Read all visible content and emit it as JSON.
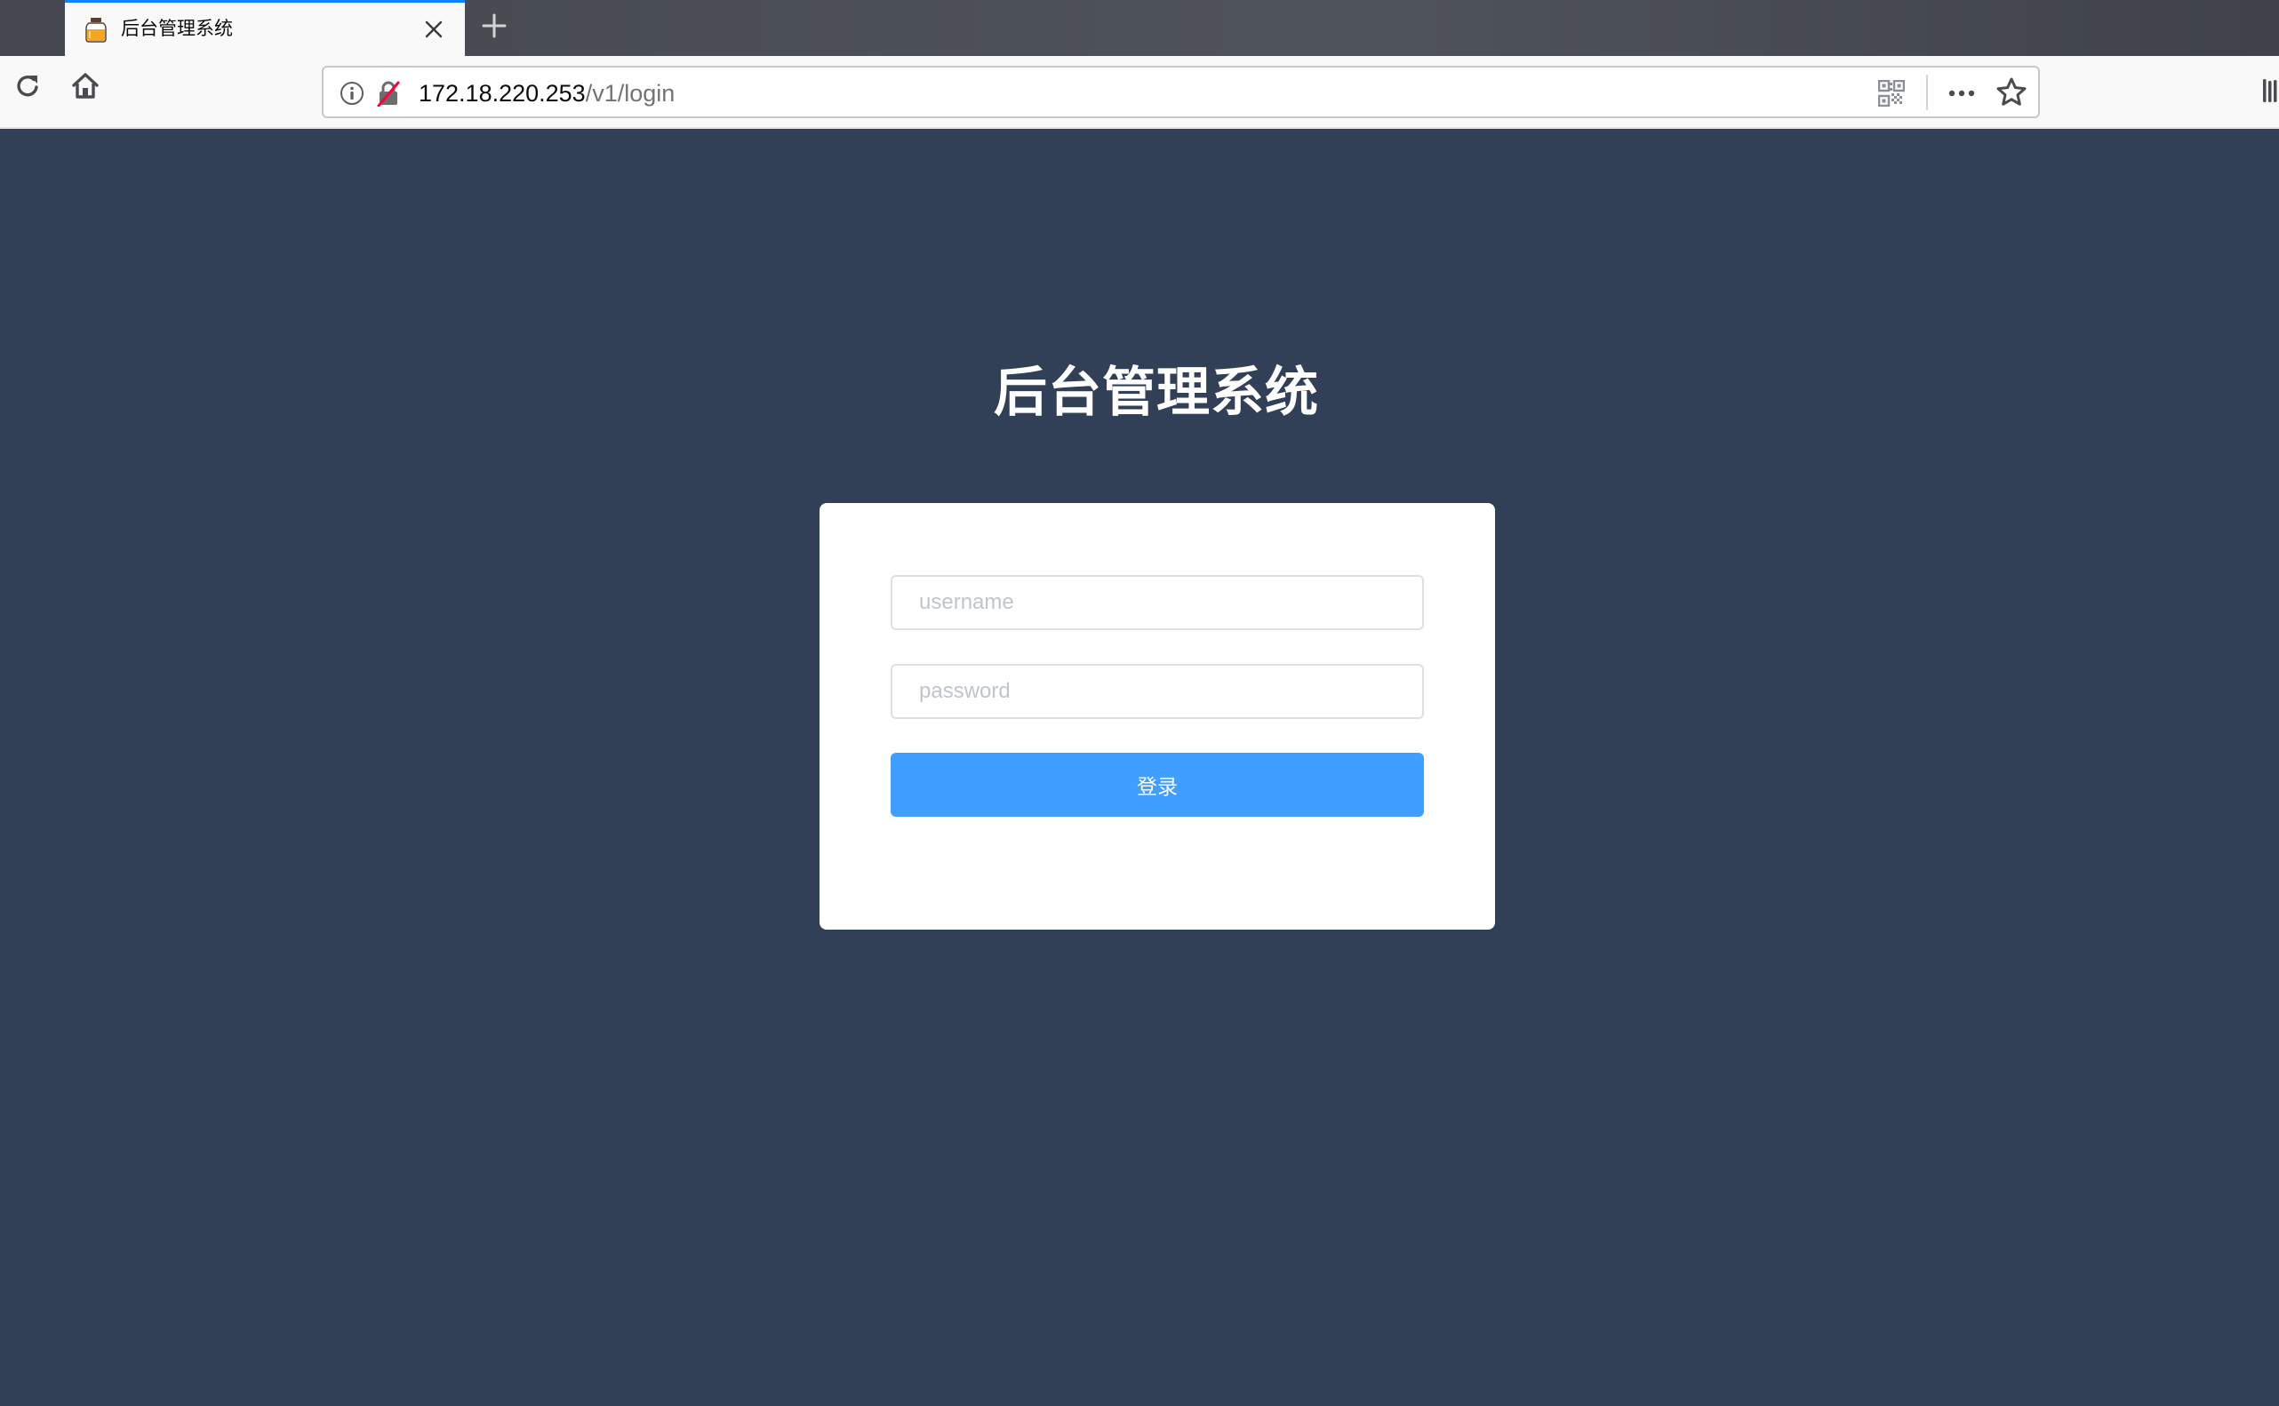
{
  "browser": {
    "tab": {
      "title": "后台管理系统",
      "favicon": "jar-icon",
      "close_icon": "close-icon"
    },
    "new_tab_icon": "plus-icon",
    "toolbar": {
      "reload_icon": "reload-icon",
      "home_icon": "home-icon",
      "library_icon": "library-icon"
    },
    "urlbar": {
      "host": "172.18.220.253",
      "path": "/v1/login",
      "info_icon": "info-icon",
      "insecure_icon": "insecure-lock-icon",
      "qr_icon": "qr-code-icon",
      "more_icon": "more-actions-icon",
      "bookmark_icon": "bookmark-star-icon"
    }
  },
  "colors": {
    "page_background": "#324057",
    "primary_button": "#409eff",
    "tab_accent": "#0a84ff",
    "insecure_slash": "#ff0039"
  },
  "login": {
    "title": "后台管理系统",
    "username": {
      "value": "",
      "placeholder": "username"
    },
    "password": {
      "value": "",
      "placeholder": "password"
    },
    "submit_label": "登录"
  }
}
